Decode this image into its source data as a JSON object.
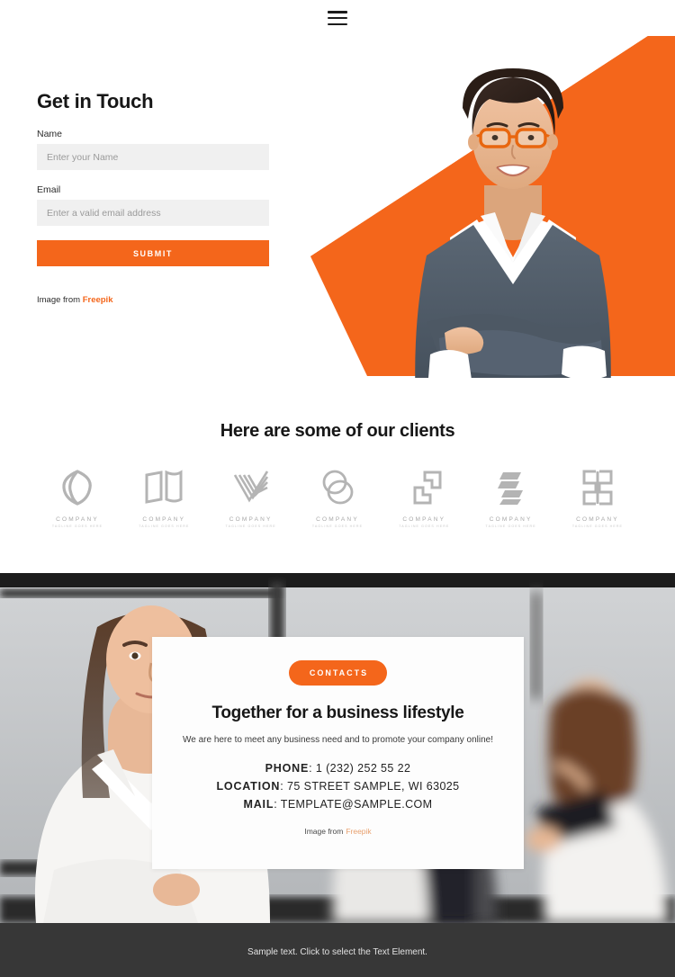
{
  "header": {
    "menu_icon": "hamburger-menu-icon"
  },
  "hero": {
    "title": "Get in Touch",
    "name_label": "Name",
    "name_placeholder": "Enter your Name",
    "name_value": "",
    "email_label": "Email",
    "email_placeholder": "Enter a valid email address",
    "email_value": "",
    "submit_label": "SUBMIT",
    "credit_prefix": "Image from ",
    "credit_link": "Freepik",
    "shape_color": "#F4661B",
    "photo_alt": "smiling businesswoman with orange glasses, arms crossed"
  },
  "clients": {
    "title": "Here are some of our clients",
    "logos": [
      {
        "name": "COMPANY",
        "tagline": "TAGLINE GOES HERE",
        "mark": "leaf-circle-logo-icon"
      },
      {
        "name": "COMPANY",
        "tagline": "TAGLINE GOES HERE",
        "mark": "open-book-logo-icon"
      },
      {
        "name": "COMPANY",
        "tagline": "TAGLINE GOES HERE",
        "mark": "chevron-stripes-logo-icon"
      },
      {
        "name": "COMPANY",
        "tagline": "TAGLINE GOES HERE",
        "mark": "overlapping-circles-logo-icon"
      },
      {
        "name": "COMPANY",
        "tagline": "TAGLINE GOES HERE",
        "mark": "two-squares-logo-icon"
      },
      {
        "name": "COMPANY",
        "tagline": "TAGLINE GOES HERE",
        "mark": "diagonal-bars-logo-icon"
      },
      {
        "name": "COMPANY",
        "tagline": "TAGLINE GOES HERE",
        "mark": "mirrored-brackets-logo-icon"
      }
    ]
  },
  "contact": {
    "badge_label": "CONTACTS",
    "heading": "Together for a business lifestyle",
    "subheading": "We are here to meet any business need and to promote your company online!",
    "details": [
      {
        "label": "PHONE",
        "value": "1 (232) 252 55 22"
      },
      {
        "label": "LOCATION",
        "value": "75 STREET SAMPLE, WI 63025"
      },
      {
        "label": "MAIL",
        "value": "TEMPLATE@SAMPLE.COM"
      }
    ],
    "credit_prefix": "Image from",
    "credit_link": "Freepik",
    "photo_alt": "team of businesswomen in a bright office"
  },
  "footer": {
    "text": "Sample text. Click to select the Text Element.",
    "background": "#373737"
  }
}
